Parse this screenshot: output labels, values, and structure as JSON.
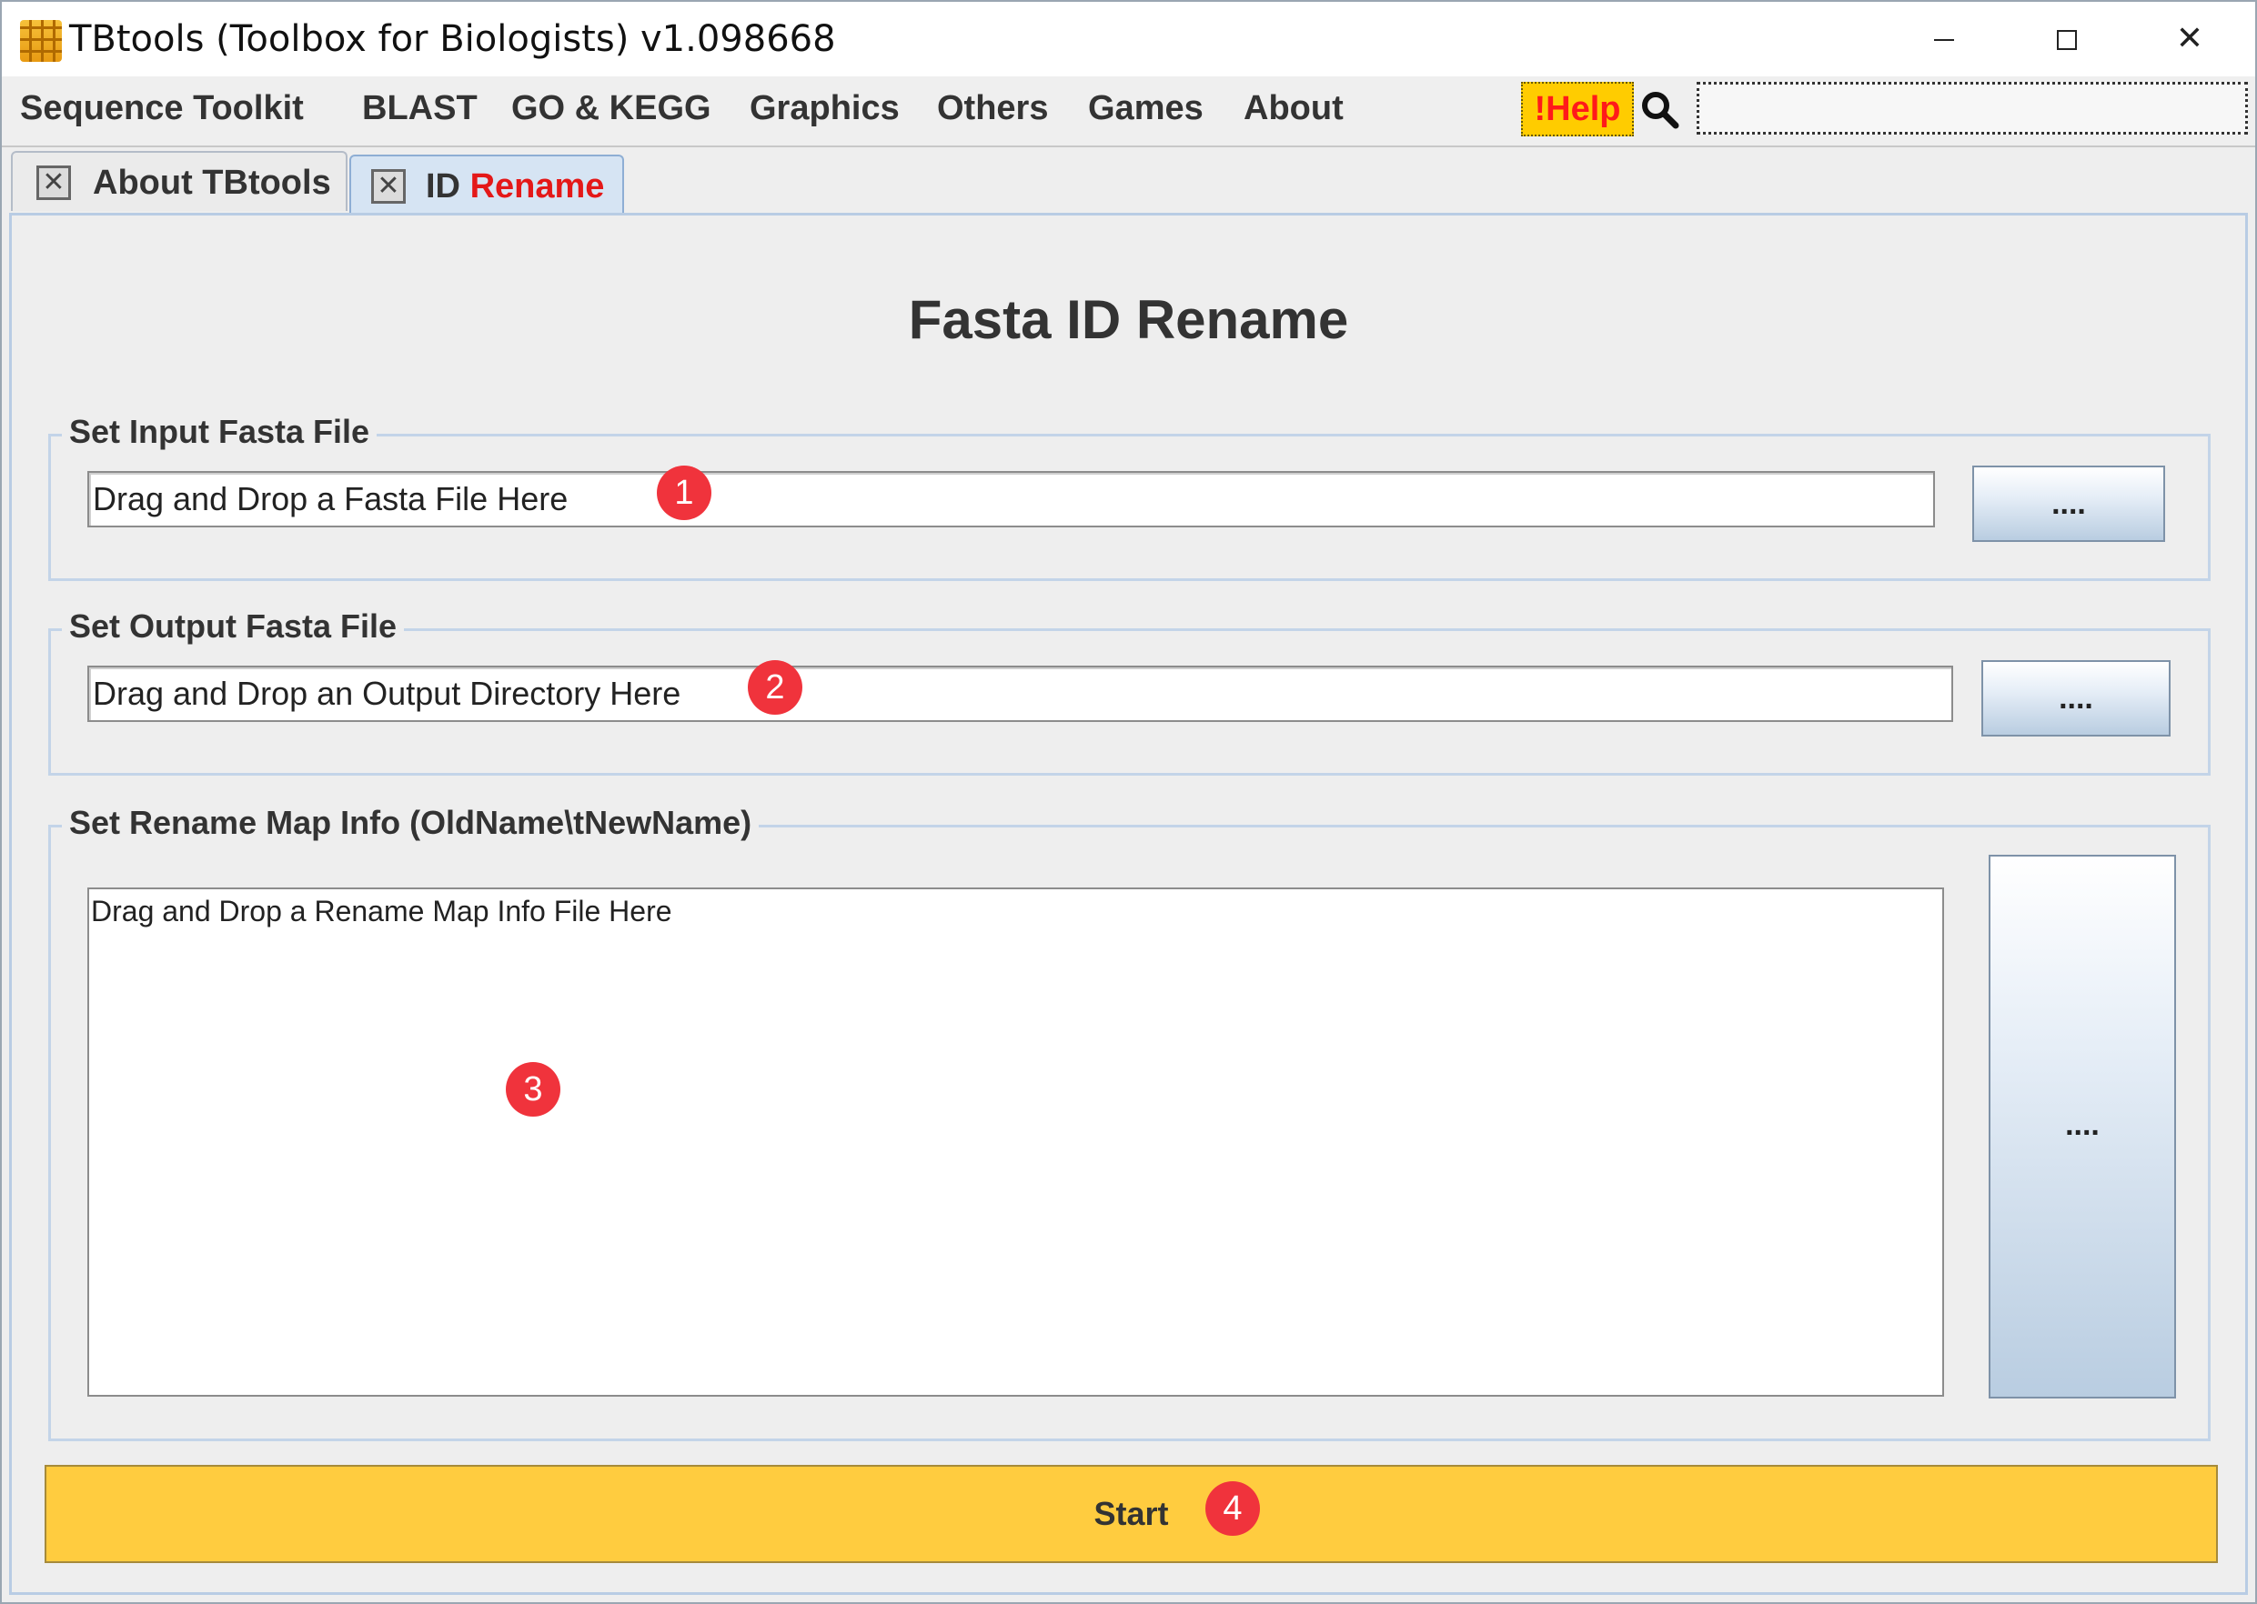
{
  "window": {
    "title": "TBtools (Toolbox for Biologists) v1.098668",
    "minimize_label": "",
    "maximize_label": "",
    "close_label": "✕"
  },
  "menu": {
    "items": [
      "Sequence Toolkit",
      "BLAST",
      "GO & KEGG",
      "Graphics",
      "Others",
      "Games",
      "About"
    ],
    "help_label": "!Help",
    "search_value": ""
  },
  "tabs": {
    "about_label": "About TBtools",
    "rename_label_prefix": "ID",
    "rename_label_suffix": "Rename",
    "close_glyph": "✕"
  },
  "main": {
    "heading": "Fasta ID Rename",
    "input_group": {
      "title": "Set Input Fasta File",
      "value": "Drag and Drop a Fasta File Here",
      "button_label": "...."
    },
    "output_group": {
      "title": "Set Output Fasta File",
      "value": "Drag and Drop an Output Directory Here",
      "button_label": "...."
    },
    "map_group": {
      "title": "Set Rename Map Info (OldName\\tNewName)",
      "value": "Drag and Drop a Rename Map Info File Here",
      "button_label": "...."
    },
    "start_label": "Start"
  },
  "markers": [
    "1",
    "2",
    "3",
    "4"
  ],
  "colors": {
    "accent_yellow": "#ffcc3f",
    "help_yellow": "#ffcc00",
    "marker_red": "#f0333c",
    "tab_red": "#e41818"
  }
}
